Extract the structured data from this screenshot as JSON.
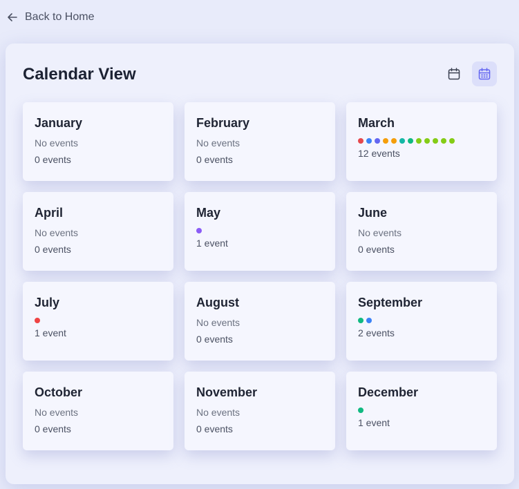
{
  "nav": {
    "back_label": "Back to Home"
  },
  "panel": {
    "title": "Calendar View"
  },
  "months": [
    {
      "name": "January",
      "empty_label": "No events",
      "count_label": "0 events",
      "dots": []
    },
    {
      "name": "February",
      "empty_label": "No events",
      "count_label": "0 events",
      "dots": []
    },
    {
      "name": "March",
      "empty_label": "",
      "count_label": "12 events",
      "dots": [
        "#e5484d",
        "#3b82f6",
        "#6366f1",
        "#f59e0b",
        "#f59e0b",
        "#14b8a6",
        "#10b981",
        "#84cc16",
        "#84cc16",
        "#84cc16",
        "#84cc16",
        "#84cc16"
      ]
    },
    {
      "name": "April",
      "empty_label": "No events",
      "count_label": "0 events",
      "dots": []
    },
    {
      "name": "May",
      "empty_label": "",
      "count_label": "1 event",
      "dots": [
        "#8b5cf6"
      ]
    },
    {
      "name": "June",
      "empty_label": "No events",
      "count_label": "0 events",
      "dots": []
    },
    {
      "name": "July",
      "empty_label": "",
      "count_label": "1 event",
      "dots": [
        "#ef4444"
      ]
    },
    {
      "name": "August",
      "empty_label": "No events",
      "count_label": "0 events",
      "dots": []
    },
    {
      "name": "September",
      "empty_label": "",
      "count_label": "2 events",
      "dots": [
        "#10b981",
        "#3b82f6"
      ]
    },
    {
      "name": "October",
      "empty_label": "No events",
      "count_label": "0 events",
      "dots": []
    },
    {
      "name": "November",
      "empty_label": "No events",
      "count_label": "0 events",
      "dots": []
    },
    {
      "name": "December",
      "empty_label": "",
      "count_label": "1 event",
      "dots": [
        "#10b981"
      ]
    }
  ],
  "icons": {
    "back": "arrow-left-icon",
    "month_view": "calendar-icon",
    "year_view": "calendar-grid-icon"
  },
  "colors": {
    "active_view_bg": "#dcdffa",
    "active_view_icon": "#6366f1"
  }
}
